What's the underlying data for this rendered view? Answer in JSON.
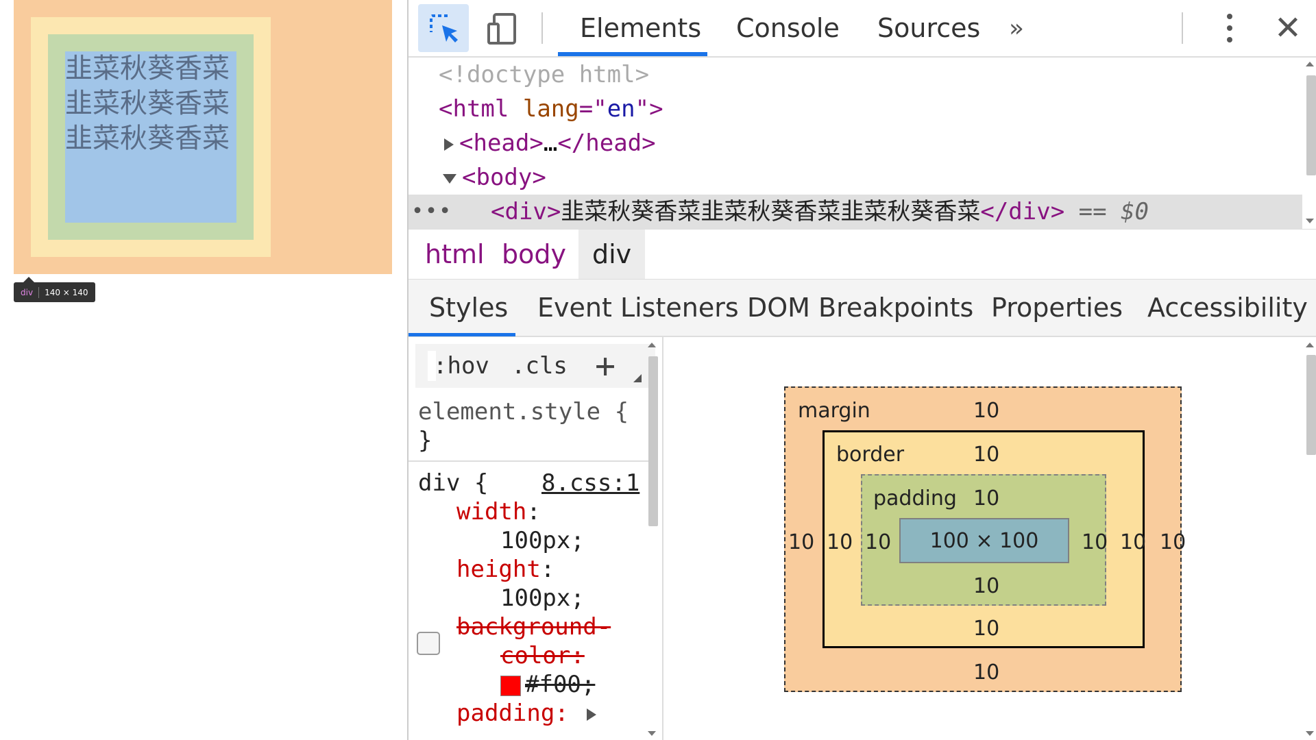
{
  "page": {
    "div_text_lines": [
      "韭菜秋葵香菜",
      "韭菜秋葵香菜",
      "韭菜秋葵香菜"
    ],
    "tooltip": {
      "tag": "div",
      "size": "140 × 140"
    }
  },
  "toolbar": {
    "tabs": [
      "Elements",
      "Console",
      "Sources"
    ],
    "active_tab": "Elements",
    "more_label": "»",
    "close_label": "✕"
  },
  "dom": {
    "doctype": "<!doctype html>",
    "html_open": "<html",
    "html_attr_name": "lang",
    "html_attr_eq": "=\"",
    "html_attr_value": "en",
    "html_attr_close": "\">",
    "head_open": "<head>",
    "head_ellipsis": "…",
    "head_close": "</head>",
    "body_open": "<body>",
    "ellipsis": "•••",
    "div_open": "<div>",
    "div_text": "韭菜秋葵香菜韭菜秋葵香菜韭菜秋葵香菜",
    "div_close": "</div>",
    "selected_marker": "== $0"
  },
  "breadcrumb": [
    "html",
    "body",
    "div"
  ],
  "subtabs": [
    "Styles",
    "Event Listeners",
    "DOM Breakpoints",
    "Properties",
    "Accessibility"
  ],
  "styles": {
    "hov": ":hov",
    "cls": ".cls",
    "plus": "+",
    "element_style_open": "element.style {",
    "close_brace": "}",
    "div_selector": "div {",
    "source_link": "8.css:1",
    "props": [
      {
        "name": "width",
        "value": "100px;"
      },
      {
        "name": "height",
        "value": "100px;"
      }
    ],
    "struck_prop_line1": "background-",
    "struck_prop_line2": "color:",
    "struck_value": "#f00;",
    "struck_color": "#ff0000",
    "next_prop": "padding:"
  },
  "boxmodel": {
    "margin_label": "margin",
    "border_label": "border",
    "padding_label": "padding",
    "margin": {
      "top": "10",
      "right": "10",
      "bottom": "10",
      "left": "10"
    },
    "border": {
      "top": "10",
      "right": "10",
      "bottom": "10",
      "left": "10"
    },
    "padding": {
      "top": "10",
      "right": "10",
      "bottom": "10",
      "left": "10"
    },
    "content": "100 × 100"
  },
  "colors": {
    "margin": "#f9cc9d",
    "border": "#fcdf9d",
    "padding": "#c3d08b",
    "content": "#8cb6c0",
    "accent": "#1a73e8"
  }
}
